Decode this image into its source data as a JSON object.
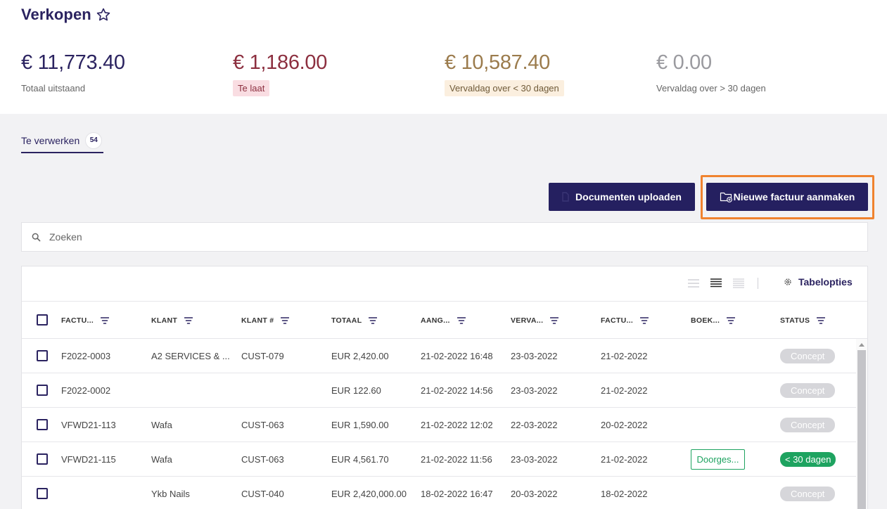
{
  "page": {
    "title": "Verkopen"
  },
  "stats": [
    {
      "value": "€ 11,773.40",
      "label": "Totaal uitstaand",
      "color": "#2b2360"
    },
    {
      "value": "€ 1,186.00",
      "label": "Te laat",
      "color": "#8c2f3f",
      "badge_bg": "#f9dde2"
    },
    {
      "value": "€ 10,587.40",
      "label": "Vervaldag over < 30 dagen",
      "color": "#9b7b4c",
      "badge_bg": "#fbefdf"
    },
    {
      "value": "€ 0.00",
      "label": "Vervaldag over > 30 dagen",
      "color": "#9a9a9f"
    }
  ],
  "tabs": [
    {
      "label": "Te verwerken",
      "count": "54"
    }
  ],
  "actions": {
    "upload_label": "Documenten uploaden",
    "new_invoice_label": "Nieuwe factuur aanmaken"
  },
  "search": {
    "placeholder": "Zoeken"
  },
  "table": {
    "options_label": "Tabelopties",
    "columns": [
      "FACTU...",
      "KLANT",
      "KLANT #",
      "TOTAAL",
      "AANG...",
      "VERVA...",
      "FACTU...",
      "BOEK...",
      "STATUS"
    ],
    "rows": [
      [
        "F2022-0003",
        "A2 SERVICES & ...",
        "CUST-079",
        "EUR 2,420.00",
        "21-02-2022 16:48",
        "23-03-2022",
        "21-02-2022",
        "",
        "Concept"
      ],
      [
        "F2022-0002",
        "",
        "",
        "EUR 122.60",
        "21-02-2022 14:56",
        "23-03-2022",
        "21-02-2022",
        "",
        "Concept"
      ],
      [
        "VFWD21-113",
        "Wafa",
        "CUST-063",
        "EUR 1,590.00",
        "21-02-2022 12:02",
        "22-03-2022",
        "20-02-2022",
        "",
        "Concept"
      ],
      [
        "VFWD21-115",
        "Wafa",
        "CUST-063",
        "EUR 4,561.70",
        "21-02-2022 11:56",
        "23-03-2022",
        "21-02-2022",
        "Doorges...",
        "< 30 dagen"
      ],
      [
        "",
        "Ykb Nails",
        "CUST-040",
        "EUR 2,420,000.00",
        "18-02-2022 16:47",
        "20-03-2022",
        "18-02-2022",
        "",
        "Concept"
      ]
    ]
  },
  "colors": {
    "primary": "#252060",
    "highlight": "#f0832f",
    "success": "#1ea360",
    "concept": "#d6d6da"
  }
}
